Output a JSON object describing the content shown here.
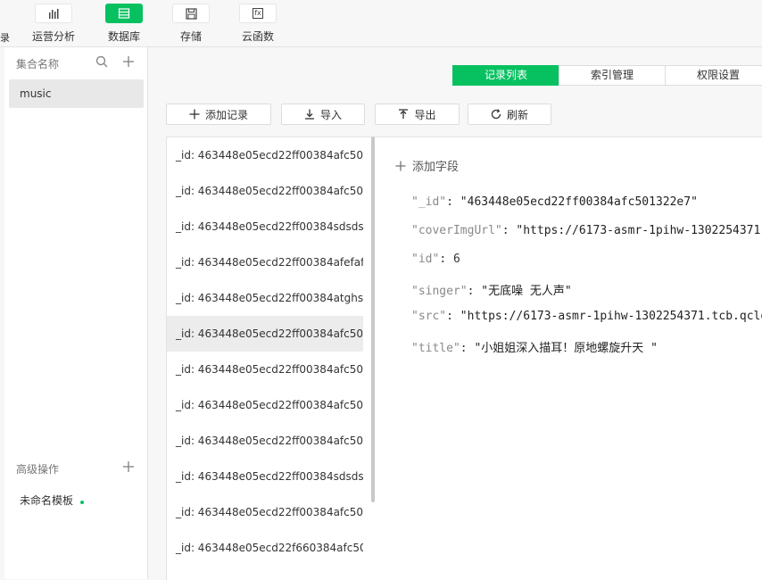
{
  "toolbar": {
    "edge_glyph": "录",
    "items": [
      {
        "label": "运营分析",
        "icon": "bar-chart-icon"
      },
      {
        "label": "数据库",
        "icon": "database-icon"
      },
      {
        "label": "存储",
        "icon": "save-icon"
      },
      {
        "label": "云函数",
        "icon": "function-icon"
      }
    ],
    "function_icon_text": "fx"
  },
  "sidebar": {
    "collections_title": "集合名称",
    "collections": [
      "music"
    ],
    "advanced_title": "高级操作",
    "template": "未命名模板"
  },
  "tabs": [
    {
      "label": "记录列表"
    },
    {
      "label": "索引管理"
    },
    {
      "label": "权限设置"
    }
  ],
  "actions": {
    "add": "添加记录",
    "import": "导入",
    "export": "导出",
    "refresh": "刷新"
  },
  "records": [
    "_id: 463448e05ecd22ff00384afc50...",
    "_id: 463448e05ecd22ff00384afc50...",
    "_id: 463448e05ecd22ff00384sdsds...",
    "_id: 463448e05ecd22ff00384afefaf...",
    "_id: 463448e05ecd22ff00384atghs...",
    "_id: 463448e05ecd22ff00384afc50...",
    "_id: 463448e05ecd22ff00384afc50...",
    "_id: 463448e05ecd22ff00384afc50...",
    "_id: 463448e05ecd22ff00384afc50...",
    "_id: 463448e05ecd22ff00384sdsds...",
    "_id: 463448e05ecd22ff00384afc50...",
    "_id: 463448e05ecd22f660384afc50..."
  ],
  "detail": {
    "add_field": "添加字段",
    "fields": [
      {
        "key": "\"_id\"",
        "value": "\"463448e05ecd22ff00384afc501322e7\""
      },
      {
        "key": "\"coverImgUrl\"",
        "value": "\"https://6173-asmr-1pihw-1302254371."
      },
      {
        "key": "\"id\"",
        "value": "6"
      },
      {
        "key": "\"singer\"",
        "value": "\"无底噪 无人声\""
      },
      {
        "key": "\"src\"",
        "value": "\"https://6173-asmr-1pihw-1302254371.tcb.qclo"
      },
      {
        "key": "\"title\"",
        "value": "\"小姐姐深入描耳！原地螺旋升天 \""
      }
    ]
  },
  "colors": {
    "accent": "#07c160"
  }
}
